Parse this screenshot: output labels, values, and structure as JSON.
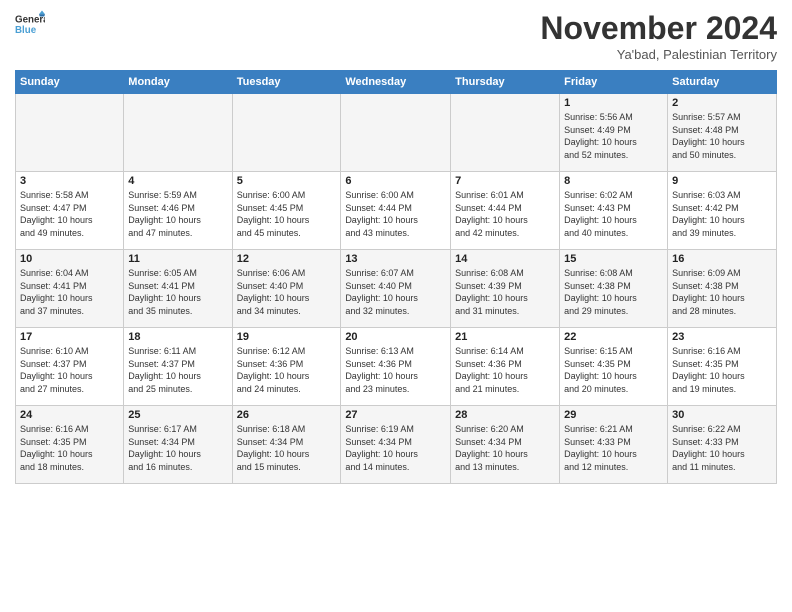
{
  "header": {
    "logo_line1": "General",
    "logo_line2": "Blue",
    "month": "November 2024",
    "location": "Ya'bad, Palestinian Territory"
  },
  "weekdays": [
    "Sunday",
    "Monday",
    "Tuesday",
    "Wednesday",
    "Thursday",
    "Friday",
    "Saturday"
  ],
  "weeks": [
    [
      {
        "day": "",
        "info": ""
      },
      {
        "day": "",
        "info": ""
      },
      {
        "day": "",
        "info": ""
      },
      {
        "day": "",
        "info": ""
      },
      {
        "day": "",
        "info": ""
      },
      {
        "day": "1",
        "info": "Sunrise: 5:56 AM\nSunset: 4:49 PM\nDaylight: 10 hours\nand 52 minutes."
      },
      {
        "day": "2",
        "info": "Sunrise: 5:57 AM\nSunset: 4:48 PM\nDaylight: 10 hours\nand 50 minutes."
      }
    ],
    [
      {
        "day": "3",
        "info": "Sunrise: 5:58 AM\nSunset: 4:47 PM\nDaylight: 10 hours\nand 49 minutes."
      },
      {
        "day": "4",
        "info": "Sunrise: 5:59 AM\nSunset: 4:46 PM\nDaylight: 10 hours\nand 47 minutes."
      },
      {
        "day": "5",
        "info": "Sunrise: 6:00 AM\nSunset: 4:45 PM\nDaylight: 10 hours\nand 45 minutes."
      },
      {
        "day": "6",
        "info": "Sunrise: 6:00 AM\nSunset: 4:44 PM\nDaylight: 10 hours\nand 43 minutes."
      },
      {
        "day": "7",
        "info": "Sunrise: 6:01 AM\nSunset: 4:44 PM\nDaylight: 10 hours\nand 42 minutes."
      },
      {
        "day": "8",
        "info": "Sunrise: 6:02 AM\nSunset: 4:43 PM\nDaylight: 10 hours\nand 40 minutes."
      },
      {
        "day": "9",
        "info": "Sunrise: 6:03 AM\nSunset: 4:42 PM\nDaylight: 10 hours\nand 39 minutes."
      }
    ],
    [
      {
        "day": "10",
        "info": "Sunrise: 6:04 AM\nSunset: 4:41 PM\nDaylight: 10 hours\nand 37 minutes."
      },
      {
        "day": "11",
        "info": "Sunrise: 6:05 AM\nSunset: 4:41 PM\nDaylight: 10 hours\nand 35 minutes."
      },
      {
        "day": "12",
        "info": "Sunrise: 6:06 AM\nSunset: 4:40 PM\nDaylight: 10 hours\nand 34 minutes."
      },
      {
        "day": "13",
        "info": "Sunrise: 6:07 AM\nSunset: 4:40 PM\nDaylight: 10 hours\nand 32 minutes."
      },
      {
        "day": "14",
        "info": "Sunrise: 6:08 AM\nSunset: 4:39 PM\nDaylight: 10 hours\nand 31 minutes."
      },
      {
        "day": "15",
        "info": "Sunrise: 6:08 AM\nSunset: 4:38 PM\nDaylight: 10 hours\nand 29 minutes."
      },
      {
        "day": "16",
        "info": "Sunrise: 6:09 AM\nSunset: 4:38 PM\nDaylight: 10 hours\nand 28 minutes."
      }
    ],
    [
      {
        "day": "17",
        "info": "Sunrise: 6:10 AM\nSunset: 4:37 PM\nDaylight: 10 hours\nand 27 minutes."
      },
      {
        "day": "18",
        "info": "Sunrise: 6:11 AM\nSunset: 4:37 PM\nDaylight: 10 hours\nand 25 minutes."
      },
      {
        "day": "19",
        "info": "Sunrise: 6:12 AM\nSunset: 4:36 PM\nDaylight: 10 hours\nand 24 minutes."
      },
      {
        "day": "20",
        "info": "Sunrise: 6:13 AM\nSunset: 4:36 PM\nDaylight: 10 hours\nand 23 minutes."
      },
      {
        "day": "21",
        "info": "Sunrise: 6:14 AM\nSunset: 4:36 PM\nDaylight: 10 hours\nand 21 minutes."
      },
      {
        "day": "22",
        "info": "Sunrise: 6:15 AM\nSunset: 4:35 PM\nDaylight: 10 hours\nand 20 minutes."
      },
      {
        "day": "23",
        "info": "Sunrise: 6:16 AM\nSunset: 4:35 PM\nDaylight: 10 hours\nand 19 minutes."
      }
    ],
    [
      {
        "day": "24",
        "info": "Sunrise: 6:16 AM\nSunset: 4:35 PM\nDaylight: 10 hours\nand 18 minutes."
      },
      {
        "day": "25",
        "info": "Sunrise: 6:17 AM\nSunset: 4:34 PM\nDaylight: 10 hours\nand 16 minutes."
      },
      {
        "day": "26",
        "info": "Sunrise: 6:18 AM\nSunset: 4:34 PM\nDaylight: 10 hours\nand 15 minutes."
      },
      {
        "day": "27",
        "info": "Sunrise: 6:19 AM\nSunset: 4:34 PM\nDaylight: 10 hours\nand 14 minutes."
      },
      {
        "day": "28",
        "info": "Sunrise: 6:20 AM\nSunset: 4:34 PM\nDaylight: 10 hours\nand 13 minutes."
      },
      {
        "day": "29",
        "info": "Sunrise: 6:21 AM\nSunset: 4:33 PM\nDaylight: 10 hours\nand 12 minutes."
      },
      {
        "day": "30",
        "info": "Sunrise: 6:22 AM\nSunset: 4:33 PM\nDaylight: 10 hours\nand 11 minutes."
      }
    ]
  ]
}
